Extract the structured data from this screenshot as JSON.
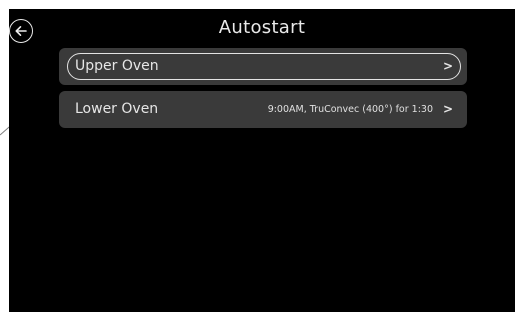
{
  "header": {
    "title": "Autostart",
    "back_icon": "arrow-left-icon"
  },
  "rows": [
    {
      "label": "Upper Oven",
      "detail": "",
      "chevron": ">",
      "selected": true
    },
    {
      "label": "Lower Oven",
      "detail": "9:00AM, TruConvec (400°) for 1:30",
      "chevron": ">",
      "selected": false
    }
  ],
  "colors": {
    "background": "#000000",
    "row": "#3a3a3a",
    "text": "#e6e6e6",
    "annotation_line": "#8a8a8a"
  }
}
